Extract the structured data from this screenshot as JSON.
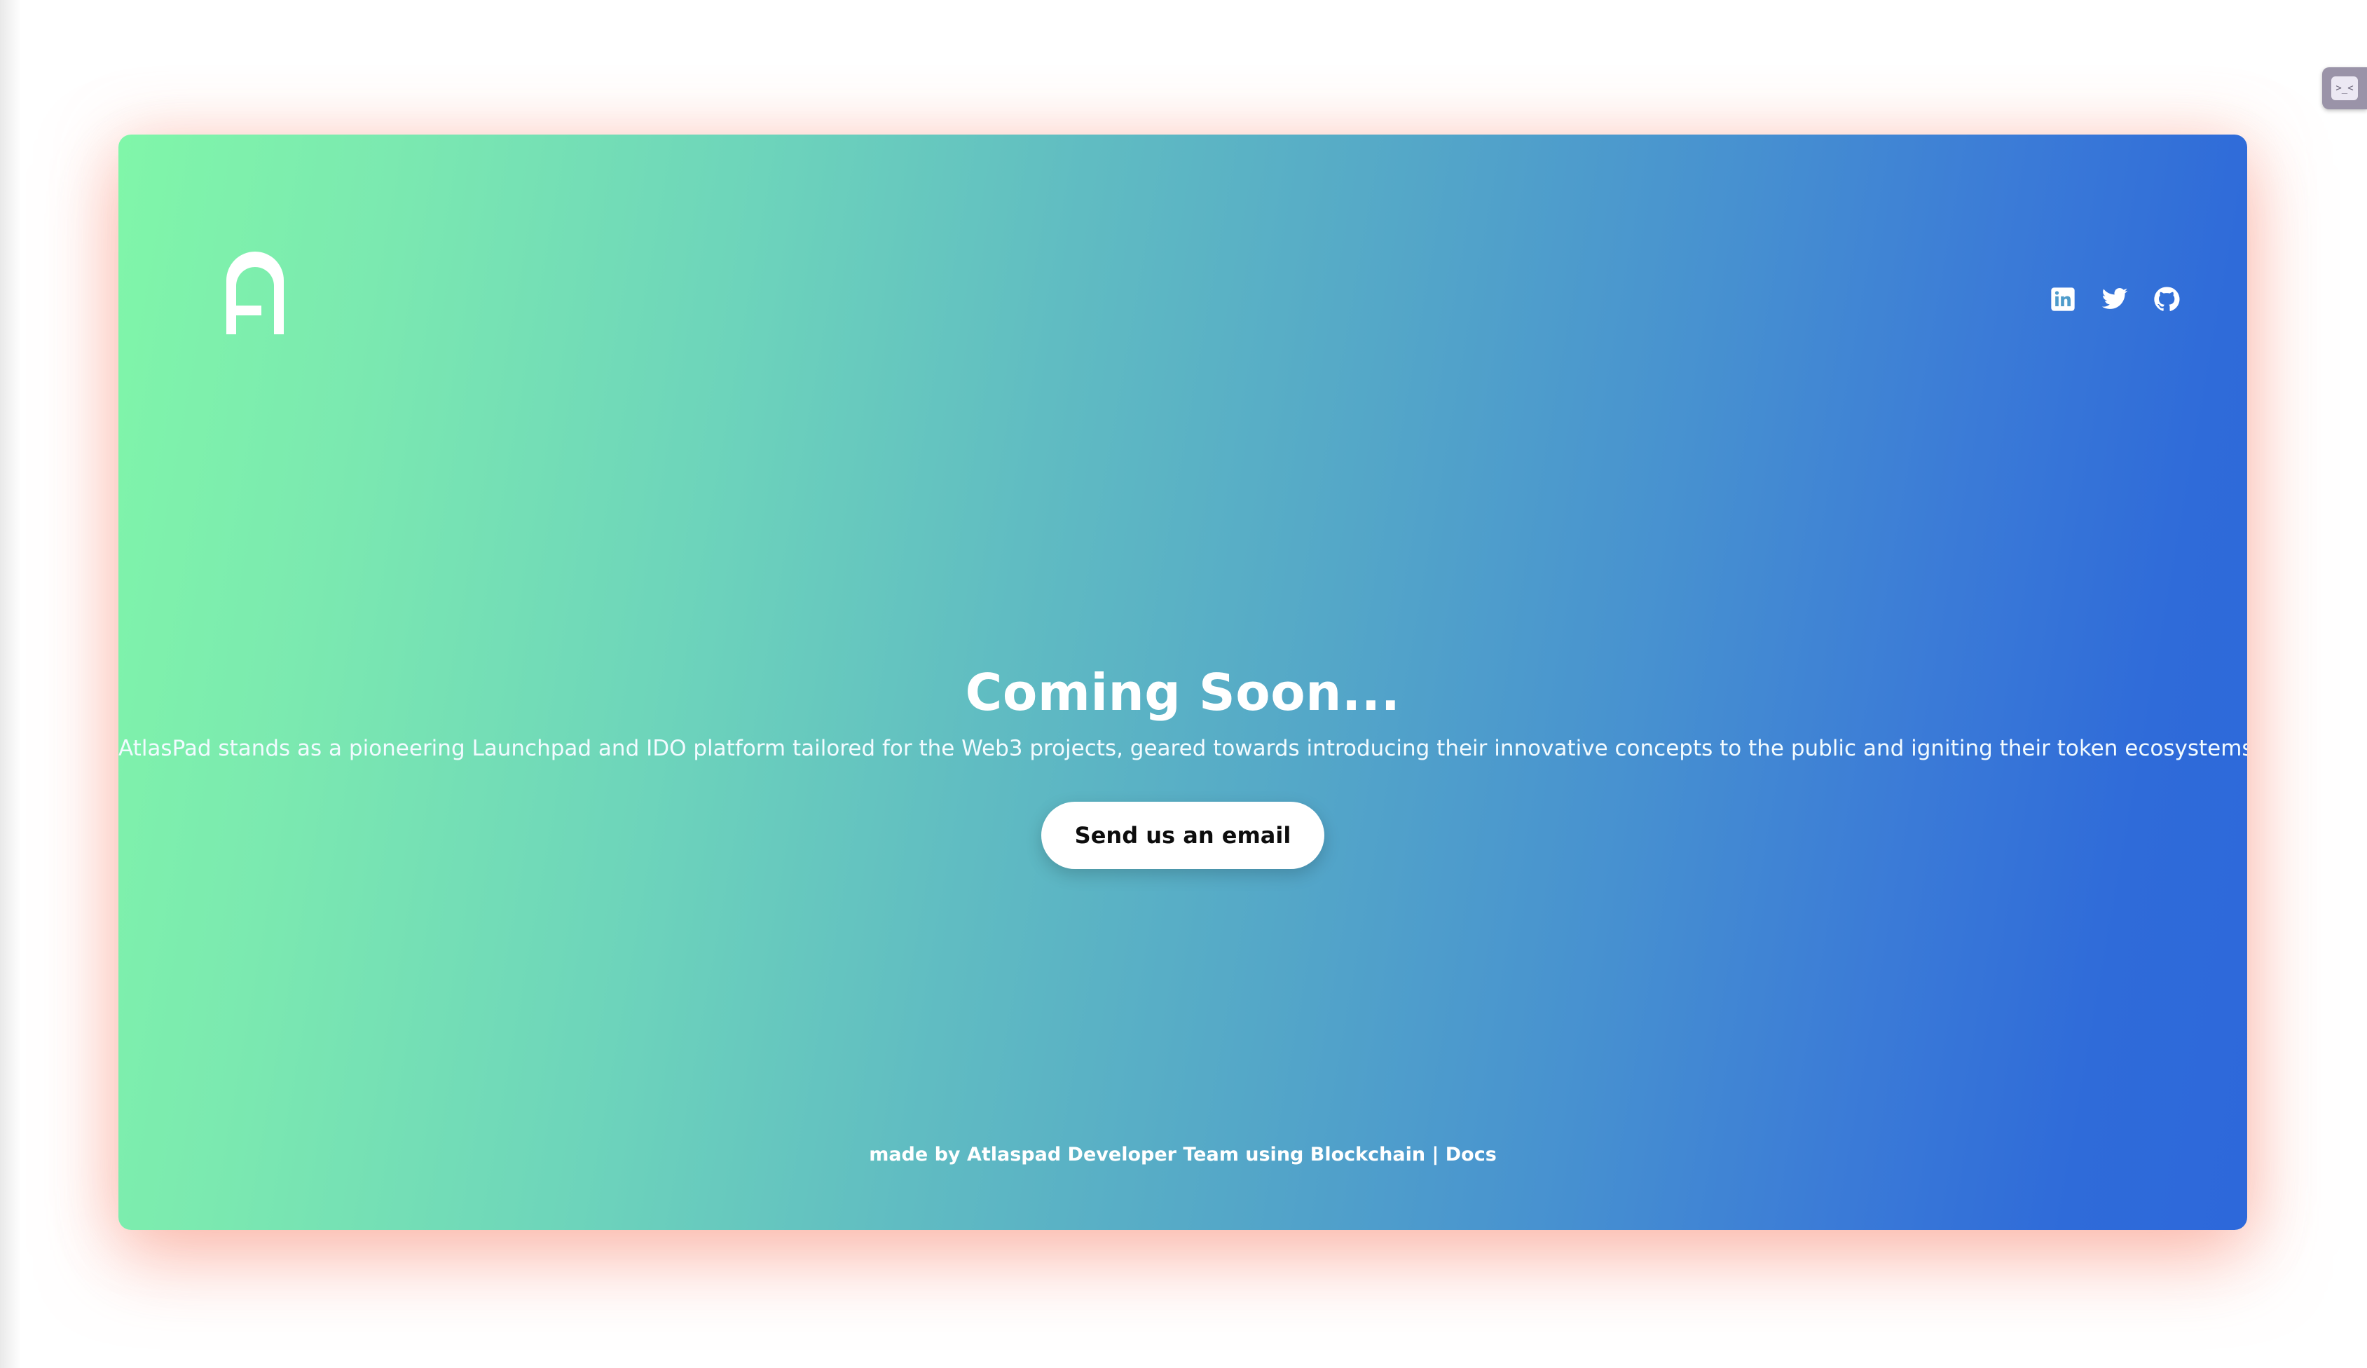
{
  "brand": {
    "logo_letter": "A"
  },
  "socials": [
    {
      "name": "linkedin",
      "icon": "linkedin-icon"
    },
    {
      "name": "twitter",
      "icon": "twitter-icon"
    },
    {
      "name": "github",
      "icon": "github-icon"
    }
  ],
  "hero": {
    "title": "Coming Soon...",
    "description": "AtlasPad stands as a pioneering Launchpad and IDO platform tailored for the Web3 projects, geared towards introducing their innovative concepts to the public and igniting their token ecosystems.",
    "cta_label": "Send us an email"
  },
  "footer": {
    "prefix": "made by",
    "team_link": "Atlaspad Developer Team",
    "middle": "using",
    "tech_link": "Blockchain",
    "separator": "|",
    "docs_link": "Docs"
  },
  "extension": {
    "icon_text": ">_<"
  },
  "colors": {
    "gradient_start": "#80f6a9",
    "gradient_end": "#2d68da",
    "glow": "#fa8c78",
    "text": "#ffffff",
    "button_bg": "#ffffff",
    "button_text": "#0d0d0d"
  }
}
